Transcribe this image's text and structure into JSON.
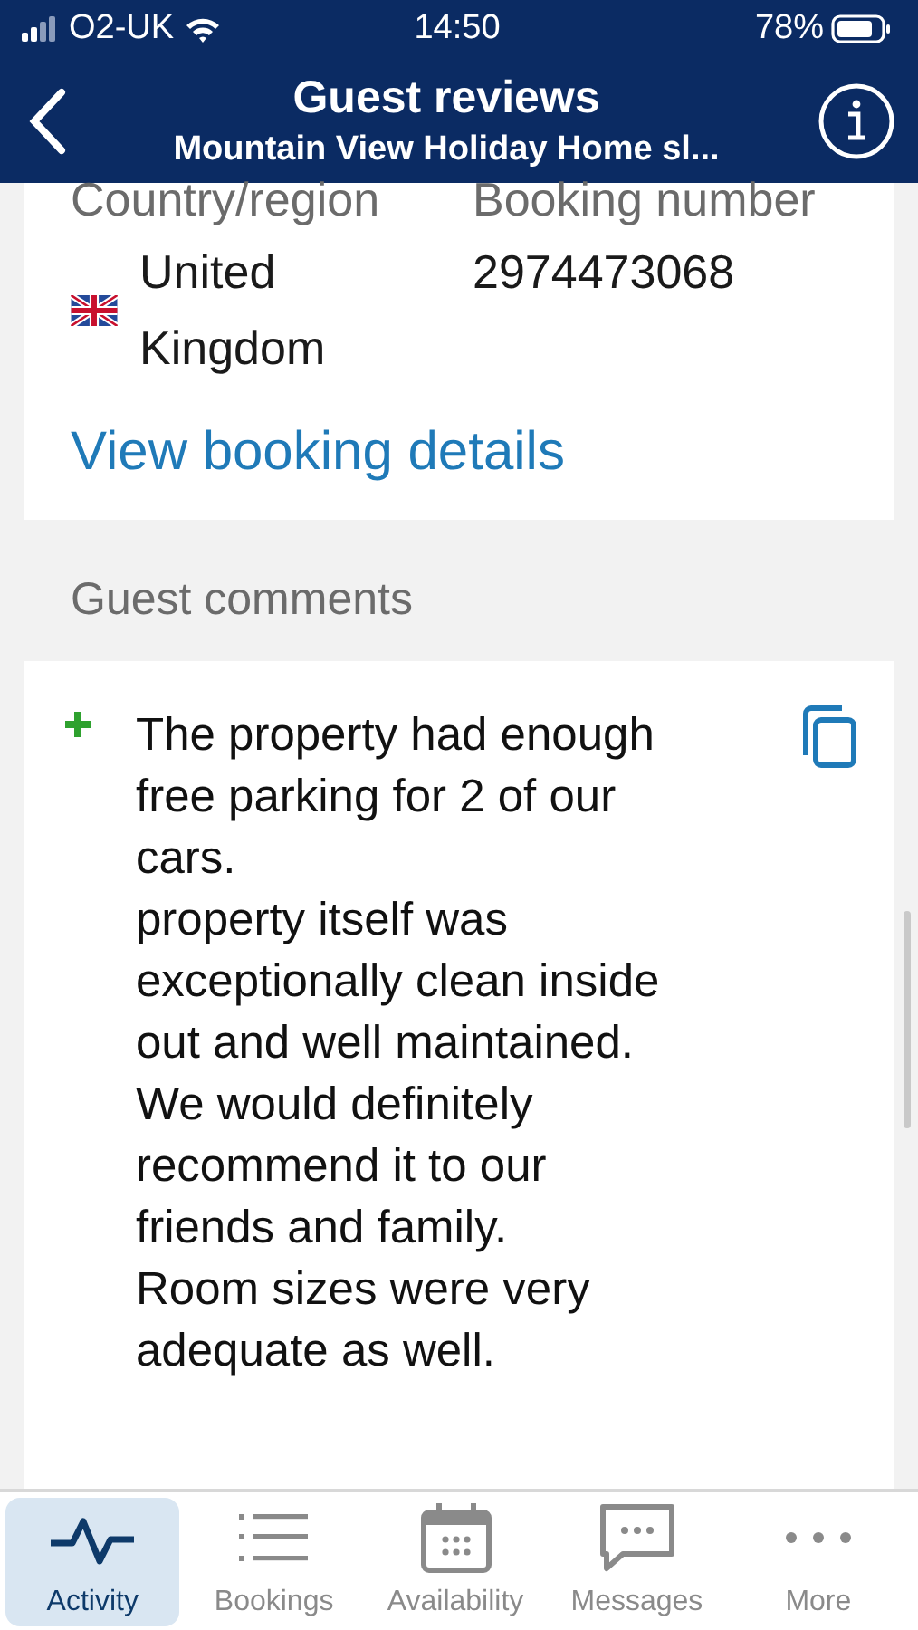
{
  "status_bar": {
    "carrier": "O2-UK",
    "time": "14:50",
    "battery": "78%"
  },
  "header": {
    "title": "Guest reviews",
    "subtitle": "Mountain View Holiday Home sl..."
  },
  "booking": {
    "fields": [
      {
        "label": "Country/region",
        "value": "United Kingdom",
        "kind": "country"
      },
      {
        "label": "Booking number",
        "value": "2974473068",
        "kind": "text"
      }
    ],
    "link": "View booking details"
  },
  "comments": {
    "heading": "Guest comments",
    "items": [
      {
        "kind": "positive",
        "text": "The property had enough free parking for 2 of our cars.\nproperty itself was exceptionally clean inside out and well maintained.\nWe would definitely recommend it to our friends and family.\nRoom sizes were very adequate as well."
      }
    ]
  },
  "tabs": [
    {
      "label": "Activity",
      "selected": true
    },
    {
      "label": "Bookings",
      "selected": false
    },
    {
      "label": "Availability",
      "selected": false
    },
    {
      "label": "Messages",
      "selected": false
    },
    {
      "label": "More",
      "selected": false
    }
  ]
}
